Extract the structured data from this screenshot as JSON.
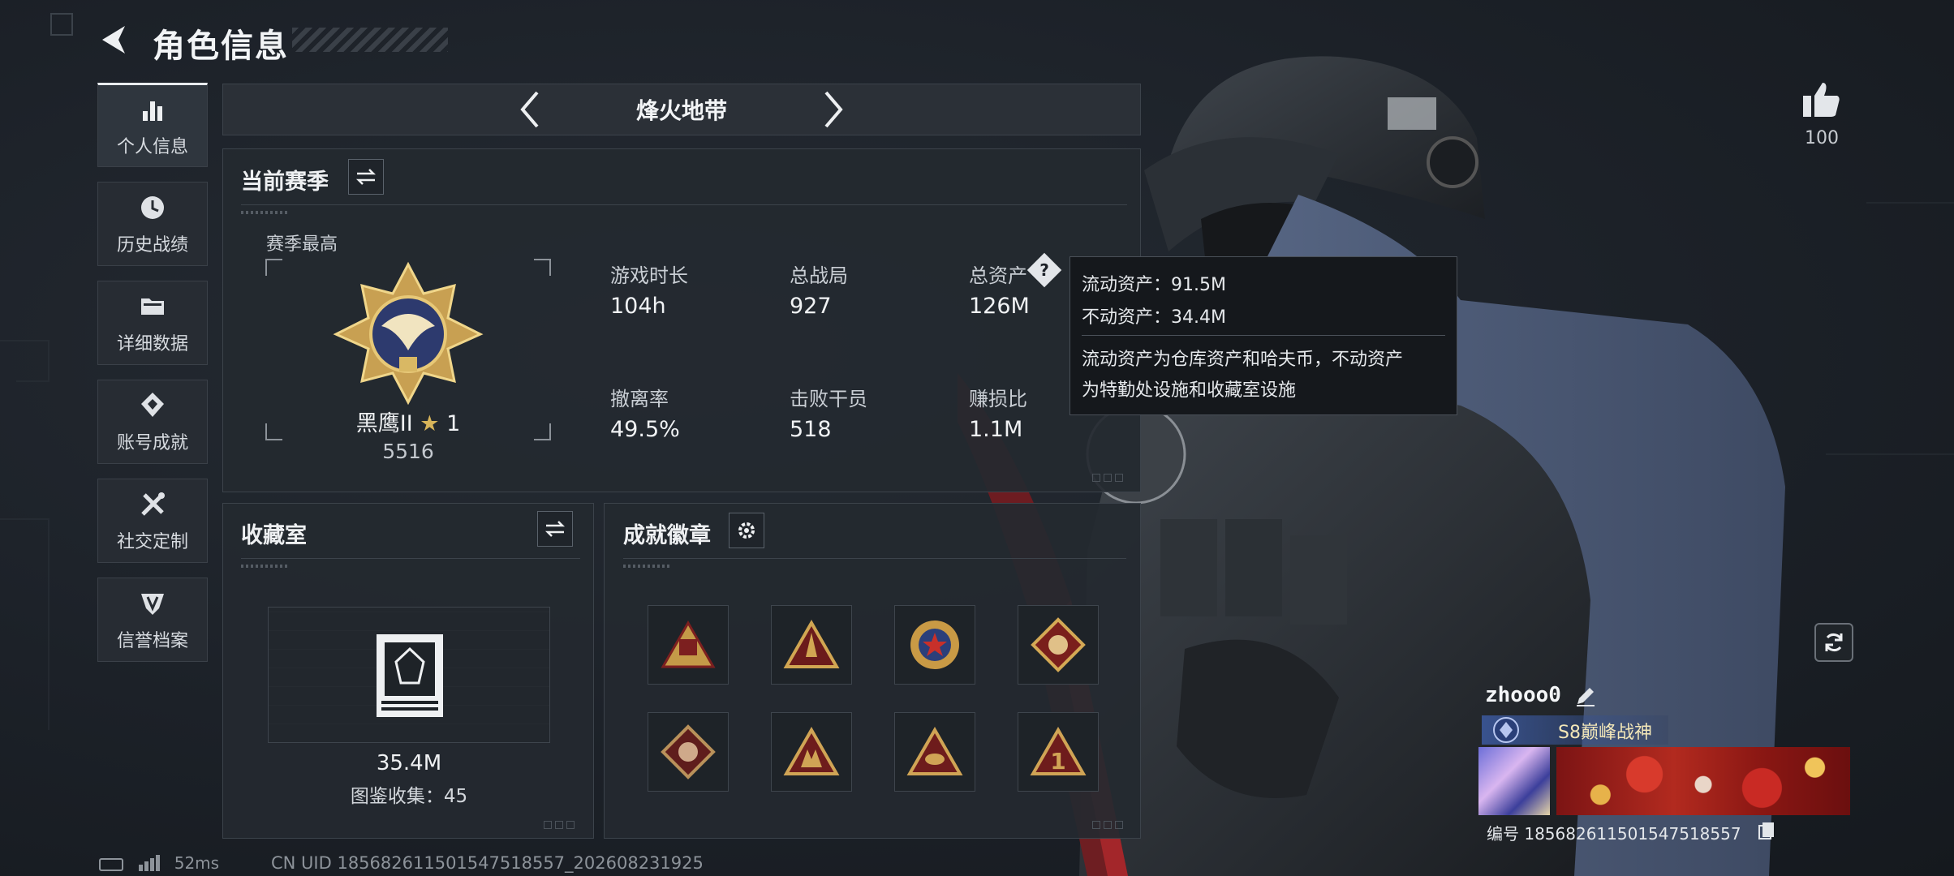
{
  "header": {
    "title": "角色信息"
  },
  "sidebar": {
    "items": [
      {
        "label": "个人信息",
        "icon": "bar-chart-icon",
        "active": true
      },
      {
        "label": "历史战绩",
        "icon": "clock-icon",
        "active": false
      },
      {
        "label": "详细数据",
        "icon": "folder-icon",
        "active": false
      },
      {
        "label": "账号成就",
        "icon": "achievement-icon",
        "active": false
      },
      {
        "label": "社交定制",
        "icon": "tools-icon",
        "active": false
      },
      {
        "label": "信誉档案",
        "icon": "shield-icon",
        "active": false
      }
    ]
  },
  "mode_tabs": {
    "current": "烽火地带",
    "prev_icon": "chevron-left-icon",
    "next_icon": "chevron-right-icon"
  },
  "season": {
    "title": "当前赛季",
    "best_label": "赛季最高",
    "rank_name": "黑鹰II",
    "rank_stars": "1",
    "rank_points": "5516",
    "stats": [
      {
        "label": "游戏时长",
        "value": "104h"
      },
      {
        "label": "总战局",
        "value": "927"
      },
      {
        "label": "总资产",
        "value": "126M"
      },
      {
        "label": "撤离率",
        "value": "49.5%"
      },
      {
        "label": "击败干员",
        "value": "518"
      },
      {
        "label": "赚损比",
        "value": "1.1M"
      }
    ]
  },
  "tooltip": {
    "liquid": "流动资产：91.5M",
    "fixed": "不动资产：34.4M",
    "desc1": "流动资产为仓库资产和哈夫币，不动资产",
    "desc2": "为特勤处设施和收藏室设施"
  },
  "collection": {
    "title": "收藏室",
    "value": "35.4M",
    "catalog": "图鉴收集：45"
  },
  "achievements": {
    "title": "成就徽章",
    "badges": [
      "badge-triangle-gold",
      "badge-triangle-rocket",
      "badge-round-star",
      "badge-diamond-dragon",
      "badge-diamond-dragon-2",
      "badge-triangle-soldiers",
      "badge-triangle-eye",
      "badge-triangle-one"
    ]
  },
  "right": {
    "like_count": "100"
  },
  "player": {
    "name": "zhooo0",
    "rank_title": "S8巅峰战神",
    "uid_line": "编号 185682611501547518557"
  },
  "footer": {
    "ping": "52ms",
    "uid": "CN UID 185682611501547518557_202608231925"
  },
  "colors": {
    "background": "#1b2027",
    "panel": "#242930",
    "accent_gold": "#d7b45a",
    "tooltip_bg": "#15181c"
  }
}
